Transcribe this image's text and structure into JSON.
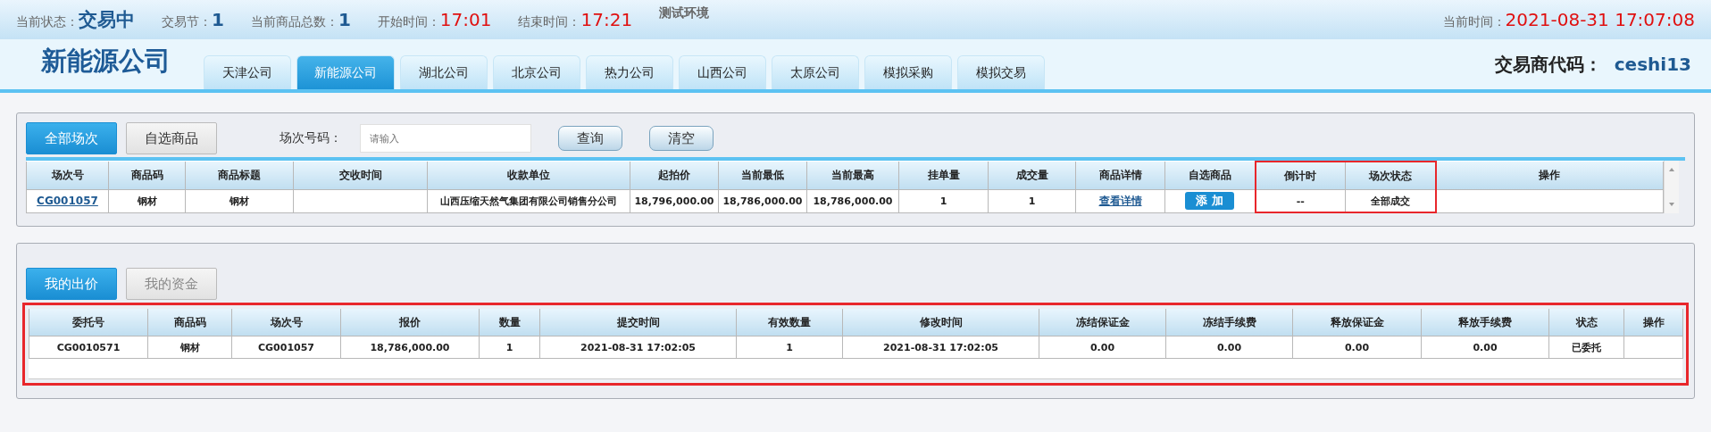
{
  "status_bar": {
    "items": [
      {
        "label": "当前状态：",
        "value": "交易中",
        "kind": "state"
      },
      {
        "label": "交易节：",
        "value": "1",
        "kind": "count"
      },
      {
        "label": "当前商品总数：",
        "value": "1",
        "kind": "count"
      },
      {
        "label": "开始时间：",
        "value": "17:01",
        "kind": "time"
      },
      {
        "label": "结束时间：",
        "value": "17:21",
        "kind": "time"
      }
    ],
    "env": "测试环境",
    "current_time": {
      "label": "当前时间：",
      "value": "2021-08-31 17:07:08"
    }
  },
  "header": {
    "company": "新能源公司",
    "tabs": [
      {
        "label": "天津公司",
        "selected": false
      },
      {
        "label": "新能源公司",
        "selected": true
      },
      {
        "label": "湖北公司",
        "selected": false
      },
      {
        "label": "北京公司",
        "selected": false
      },
      {
        "label": "热力公司",
        "selected": false
      },
      {
        "label": "山西公司",
        "selected": false
      },
      {
        "label": "太原公司",
        "selected": false
      },
      {
        "label": "模拟采购",
        "selected": false
      },
      {
        "label": "模拟交易",
        "selected": false
      }
    ],
    "trader": {
      "label": "交易商代码：",
      "value": "ceshi13"
    }
  },
  "sessions": {
    "tabs": [
      {
        "label": "全部场次",
        "selected": true
      },
      {
        "label": "自选商品",
        "selected": false
      }
    ],
    "search": {
      "label": "场次号码：",
      "placeholder": "请输入"
    },
    "buttons": [
      "查询",
      "清空"
    ],
    "table": {
      "columns": [
        {
          "label": "场次号",
          "highlighted": false
        },
        {
          "label": "商品码",
          "highlighted": false
        },
        {
          "label": "商品标题",
          "highlighted": false
        },
        {
          "label": "交收时间",
          "highlighted": false
        },
        {
          "label": "收款单位",
          "highlighted": false
        },
        {
          "label": "起拍价",
          "highlighted": false
        },
        {
          "label": "当前最低",
          "highlighted": false
        },
        {
          "label": "当前最高",
          "highlighted": false
        },
        {
          "label": "挂单量",
          "highlighted": false
        },
        {
          "label": "成交量",
          "highlighted": false
        },
        {
          "label": "商品详情",
          "highlighted": false
        },
        {
          "label": "自选商品",
          "highlighted": false
        },
        {
          "label": "倒计时",
          "highlighted": true
        },
        {
          "label": "场次状态",
          "highlighted": true
        },
        {
          "label": "操作",
          "highlighted": false
        }
      ],
      "rows": [
        {
          "cells": [
            {
              "kind": "link",
              "text": "CG001057"
            },
            {
              "kind": "text",
              "text": "钢材"
            },
            {
              "kind": "text",
              "text": "钢材"
            },
            {
              "kind": "blank"
            },
            {
              "kind": "text",
              "text": "山西压缩天然气集团有限公司销售分公司"
            },
            {
              "kind": "text",
              "text": "18,796,000.00"
            },
            {
              "kind": "text",
              "text": "18,786,000.00"
            },
            {
              "kind": "text",
              "text": "18,786,000.00"
            },
            {
              "kind": "text",
              "text": "1"
            },
            {
              "kind": "text",
              "text": "1"
            },
            {
              "kind": "link",
              "text": "查看详情"
            },
            {
              "kind": "button",
              "text": "添 加"
            },
            {
              "kind": "text",
              "text": "--"
            },
            {
              "kind": "text",
              "text": "全部成交"
            },
            {
              "kind": "blank"
            }
          ]
        }
      ]
    }
  },
  "bids": {
    "tabs": [
      {
        "label": "我的出价",
        "selected": true
      },
      {
        "label": "我的资金",
        "selected": false
      }
    ],
    "highlighted": true,
    "table": {
      "columns": [
        "委托号",
        "商品码",
        "场次号",
        "报价",
        "数量",
        "提交时间",
        "有效数量",
        "修改时间",
        "冻结保证金",
        "冻结手续费",
        "释放保证金",
        "释放手续费",
        "状态",
        "操作"
      ],
      "rows": [
        {
          "cells": [
            {
              "kind": "text",
              "text": "CG0010571"
            },
            {
              "kind": "text",
              "text": "钢材"
            },
            {
              "kind": "text",
              "text": "CG001057"
            },
            {
              "kind": "text",
              "text": "18,786,000.00"
            },
            {
              "kind": "text",
              "text": "1"
            },
            {
              "kind": "text",
              "text": "2021-08-31 17:02:05"
            },
            {
              "kind": "text",
              "text": "1"
            },
            {
              "kind": "text",
              "text": "2021-08-31 17:02:05"
            },
            {
              "kind": "text",
              "text": "0.00"
            },
            {
              "kind": "text",
              "text": "0.00"
            },
            {
              "kind": "text",
              "text": "0.00"
            },
            {
              "kind": "text",
              "text": "0.00"
            },
            {
              "kind": "text",
              "text": "已委托"
            },
            {
              "kind": "blank"
            }
          ]
        }
      ]
    }
  }
}
